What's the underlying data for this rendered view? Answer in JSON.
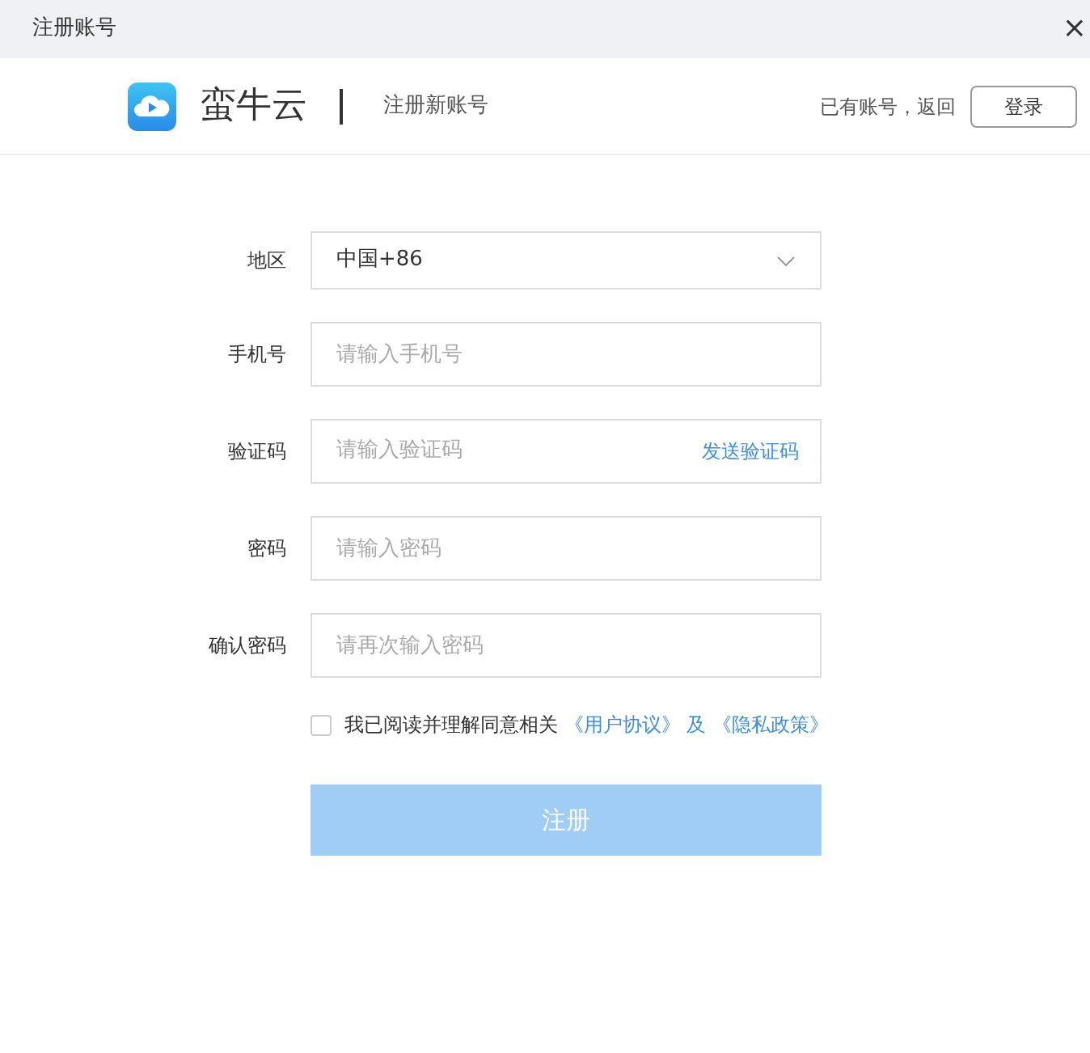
{
  "window": {
    "title": "注册账号",
    "close": "×"
  },
  "header": {
    "brand": "蛮牛云",
    "subtitle": "注册新账号",
    "login_prompt": "已有账号，返回",
    "login_button": "登录"
  },
  "form": {
    "fields": [
      {
        "kind": "select",
        "label": "地区",
        "value": "中国+86"
      },
      {
        "kind": "input",
        "label": "手机号",
        "placeholder": "请输入手机号"
      },
      {
        "kind": "code",
        "label": "验证码",
        "placeholder": "请输入验证码",
        "action": "发送验证码"
      },
      {
        "kind": "input",
        "label": "密码",
        "placeholder": "请输入密码"
      },
      {
        "kind": "input",
        "label": "确认密码",
        "placeholder": "请再次输入密码"
      }
    ],
    "agreement": {
      "checked": false,
      "text": "我已阅读并理解同意相关",
      "link_1": "《用户协议》",
      "connector": "及",
      "link_2": "《隐私政策》"
    },
    "submit": {
      "label": "注册",
      "disabled": true
    }
  }
}
